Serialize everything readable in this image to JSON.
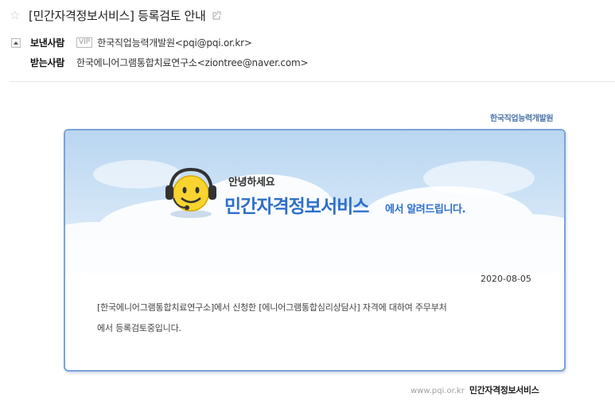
{
  "email": {
    "subject": "[민간자격정보서비스] 등록검토 안내",
    "from_label": "보낸사람",
    "vip_badge": "VIP",
    "from_value": "한국직업능력개발원<pqi@pqi.or.kr>",
    "to_label": "받는사람",
    "to_value": "한국에니어그램통합치료연구소<ziontree@naver.com>"
  },
  "banner": {
    "brand_top": "한국직업능력개발원",
    "greeting": "안녕하세요",
    "service_name": "민간자격정보서비스",
    "service_suffix": "에서 알려드립니다."
  },
  "content": {
    "date": "2020-08-05",
    "line1": "[한국에니어그램통합치료연구소]에서 신청한 [에니어그램통합심리상담사] 자격에 대하여 주무부처",
    "line2": "에서 등록검토중입니다."
  },
  "footer": {
    "url": "www.pqi.or.kr",
    "name": "민간자격정보서비스"
  },
  "icons": [
    "star-icon",
    "link-icon",
    "toggle-icon",
    "smiley-headset-icon"
  ],
  "colors": {
    "accent": "#2e6fcc",
    "card_border": "#7ba3d8",
    "sky_top": "#bcd9f2"
  }
}
